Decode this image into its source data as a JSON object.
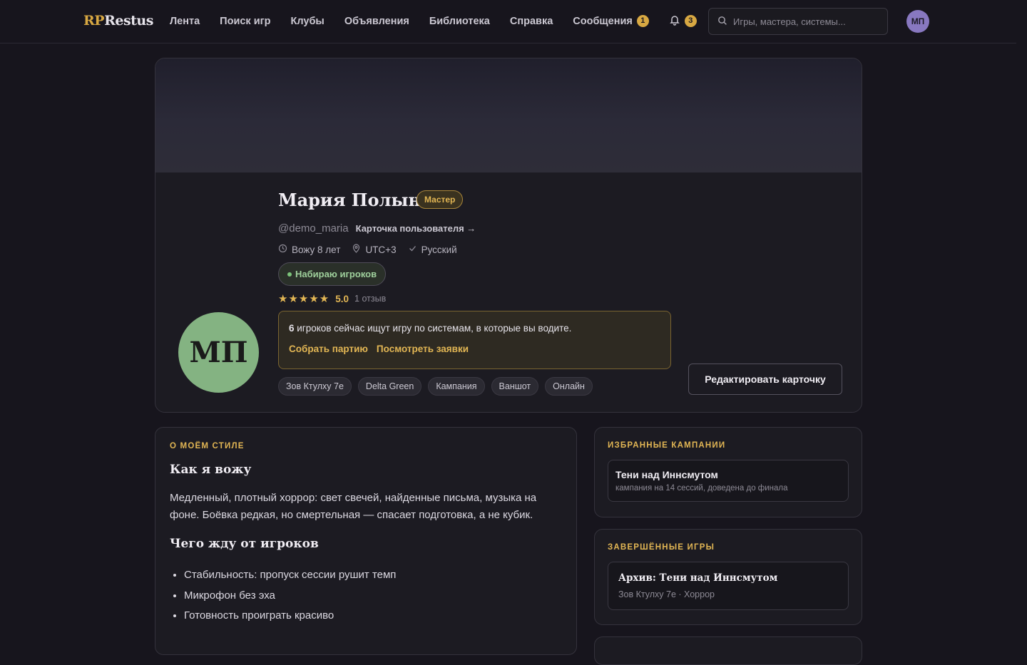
{
  "header": {
    "logo_rp": "RP",
    "logo_rest": "Restus",
    "nav": [
      {
        "label": "Лента"
      },
      {
        "label": "Поиск игр"
      },
      {
        "label": "Клубы"
      },
      {
        "label": "Объявления"
      },
      {
        "label": "Библиотека"
      },
      {
        "label": "Справка"
      },
      {
        "label": "Сообщения",
        "badge": "1"
      }
    ],
    "notifications_badge": "3",
    "search_placeholder": "Игры, мастера, системы...",
    "avatar_initials": "МП"
  },
  "profile": {
    "initials": "МП",
    "name": "Мария Полынь",
    "role": "Мастер",
    "handle": "@demo_maria",
    "card_link": "Карточка пользователя →",
    "meta": {
      "experience": "Вожу 8 лет",
      "timezone": "UTC+3",
      "language": "Русский"
    },
    "status": "Набираю игроков",
    "rating_stars": "★★★★★",
    "rating_value": "5.0",
    "review_count": "1 отзыв",
    "notice": {
      "count": "6",
      "text": " игроков сейчас ищут игру по системам, в которые вы водите.",
      "action_1": "Собрать партию",
      "action_2": "Посмотреть заявки"
    },
    "tags": [
      "Зов Ктулху 7e",
      "Delta Green",
      "Кампания",
      "Ваншот",
      "Онлайн"
    ],
    "edit_button": "Редактировать карточку"
  },
  "style_section": {
    "kicker": "О МОЁМ СТИЛЕ",
    "heading_1": "Как я вожу",
    "paragraph": "Медленный, плотный хоррор: свет свечей, найденные письма, музыка на фоне. Боёвка редкая, но смертельная — спасает подготовка, а не кубик.",
    "heading_2": "Чего жду от игроков",
    "expectations": [
      "Стабильность: пропуск сессии рушит темп",
      "Микрофон без эха",
      "Готовность проиграть красиво"
    ]
  },
  "featured_campaigns": {
    "kicker": "ИЗБРАННЫЕ КАМПАНИИ",
    "items": [
      {
        "title": "Тени над Иннсмутом",
        "subtitle": "кампания на 14 сессий, доведена до финала"
      }
    ]
  },
  "completed_games": {
    "kicker": "ЗАВЕРШЁННЫЕ ИГРЫ",
    "items": [
      {
        "title": "Архив: Тени над Иннсмутом",
        "subtitle": "Зов Ктулху 7e · Хоррор"
      }
    ]
  },
  "colors": {
    "background": "#17151d",
    "accent_gold": "#e2b654",
    "avatar_green": "#84b382",
    "status_green": "#9fd09c"
  }
}
